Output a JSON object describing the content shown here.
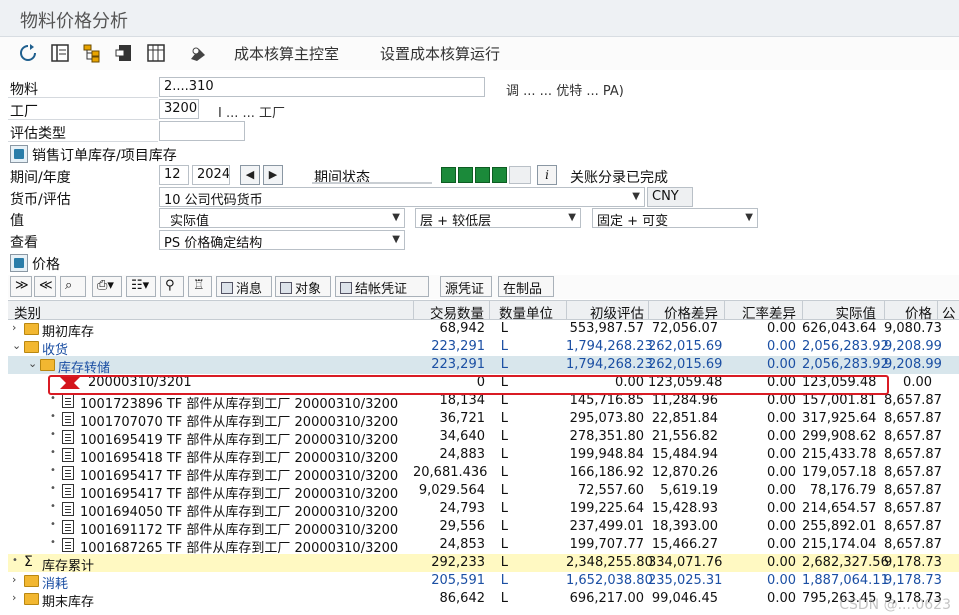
{
  "window": {
    "title": "物料价格分析"
  },
  "toolbar": {
    "costing_cockpit": "成本核算主控室",
    "costing_run_setup": "设置成本核算运行"
  },
  "selection": {
    "material_label": "物料",
    "material_value": "2....310",
    "material_desc": "调 ... ... 优特 ... PA)",
    "plant_label": "工厂",
    "plant_value": "3200",
    "plant_desc": "I ... ... 工厂",
    "valuation_type_label": "评估类型",
    "valuation_type_value": "",
    "sales_order_stock_label": "销售订单库存/项目库存",
    "period_label": "期间/年度",
    "period_value": "12",
    "year_value": "2024",
    "period_status_label": "期间状态",
    "period_status_text": "关账分录已完成",
    "currency_label": "货币/评估",
    "currency_value": "10 公司代码货币",
    "currency_code": "CNY",
    "value_label": "值",
    "value_option": "实际值",
    "level_option": "层 + 较低层",
    "fixed_option": "固定 + 可变",
    "view_label": "查看",
    "view_option": "PS 价格确定结构",
    "price_label": "价格"
  },
  "gridbar": {
    "messages": "消息",
    "objects": "对象",
    "settlement_docs": "结帐凭证",
    "source_docs": "源凭证",
    "wip": "在制品"
  },
  "columns": {
    "category": "类别",
    "quantity": "交易数量",
    "unit": "数量单位",
    "prelim": "初级评估",
    "price_diff": "价格差异",
    "fx_diff": "汇率差异",
    "actual": "实际值",
    "price": "价格",
    "extra": "公"
  },
  "rows": [
    {
      "label": "期初库存",
      "qty": "68,942",
      "unit": "L",
      "prelim": "553,987.57",
      "pdiff": "72,056.07",
      "fx": "0.00",
      "actual": "626,043.64",
      "price": "9,080.73"
    },
    {
      "label": "收货",
      "qty": "223,291",
      "unit": "L",
      "prelim": "1,794,268.23",
      "pdiff": "262,015.69",
      "fx": "0.00",
      "actual": "2,056,283.92",
      "price": "9,208.99"
    },
    {
      "label": "库存转储",
      "qty": "223,291",
      "unit": "L",
      "prelim": "1,794,268.23",
      "pdiff": "262,015.69",
      "fx": "0.00",
      "actual": "2,056,283.92",
      "price": "9,208.99"
    },
    {
      "label": "20000310/3201",
      "qty": "0",
      "unit": "L",
      "prelim": "0.00",
      "pdiff": "123,059.48",
      "fx": "0.00",
      "actual": "123,059.48",
      "price": "0.00"
    },
    {
      "label": "1001723896 TF 部件从库存到工厂 20000310/3200",
      "qty": "18,134",
      "unit": "L",
      "prelim": "145,716.85",
      "pdiff": "11,284.96",
      "fx": "0.00",
      "actual": "157,001.81",
      "price": "8,657.87"
    },
    {
      "label": "1001707070 TF 部件从库存到工厂 20000310/3200",
      "qty": "36,721",
      "unit": "L",
      "prelim": "295,073.80",
      "pdiff": "22,851.84",
      "fx": "0.00",
      "actual": "317,925.64",
      "price": "8,657.87"
    },
    {
      "label": "1001695419 TF 部件从库存到工厂 20000310/3200",
      "qty": "34,640",
      "unit": "L",
      "prelim": "278,351.80",
      "pdiff": "21,556.82",
      "fx": "0.00",
      "actual": "299,908.62",
      "price": "8,657.87"
    },
    {
      "label": "1001695418 TF 部件从库存到工厂 20000310/3200",
      "qty": "24,883",
      "unit": "L",
      "prelim": "199,948.84",
      "pdiff": "15,484.94",
      "fx": "0.00",
      "actual": "215,433.78",
      "price": "8,657.87"
    },
    {
      "label": "1001695417 TF 部件从库存到工厂 20000310/3200",
      "qty": "20,681.436",
      "unit": "L",
      "prelim": "166,186.92",
      "pdiff": "12,870.26",
      "fx": "0.00",
      "actual": "179,057.18",
      "price": "8,657.87"
    },
    {
      "label": "1001695417 TF 部件从库存到工厂 20000310/3200",
      "qty": "9,029.564",
      "unit": "L",
      "prelim": "72,557.60",
      "pdiff": "5,619.19",
      "fx": "0.00",
      "actual": "78,176.79",
      "price": "8,657.87"
    },
    {
      "label": "1001694050 TF 部件从库存到工厂 20000310/3200",
      "qty": "24,793",
      "unit": "L",
      "prelim": "199,225.64",
      "pdiff": "15,428.93",
      "fx": "0.00",
      "actual": "214,654.57",
      "price": "8,657.87"
    },
    {
      "label": "1001691172 TF 部件从库存到工厂 20000310/3200",
      "qty": "29,556",
      "unit": "L",
      "prelim": "237,499.01",
      "pdiff": "18,393.00",
      "fx": "0.00",
      "actual": "255,892.01",
      "price": "8,657.87"
    },
    {
      "label": "1001687265 TF 部件从库存到工厂 20000310/3200",
      "qty": "24,853",
      "unit": "L",
      "prelim": "199,707.77",
      "pdiff": "15,466.27",
      "fx": "0.00",
      "actual": "215,174.04",
      "price": "8,657.87"
    },
    {
      "label": "库存累计",
      "qty": "292,233",
      "unit": "L",
      "prelim": "2,348,255.80",
      "pdiff": "334,071.76",
      "fx": "0.00",
      "actual": "2,682,327.56",
      "price": "9,178.73"
    },
    {
      "label": "消耗",
      "qty": "205,591",
      "unit": "L",
      "prelim": "1,652,038.80",
      "pdiff": "235,025.31",
      "fx": "0.00",
      "actual": "1,887,064.11",
      "price": "9,178.73"
    },
    {
      "label": "期末库存",
      "qty": "86,642",
      "unit": "L",
      "prelim": "696,217.00",
      "pdiff": "99,046.45",
      "fx": "0.00",
      "actual": "795,263.45",
      "price": "9,178.73"
    }
  ],
  "watermark": "CSDN @....0623",
  "colors": {
    "highlight": "#d91b24",
    "blue_text": "#1b4fa3",
    "status_lamp": "#1b8a3a",
    "total_row": "#fff9c2"
  }
}
